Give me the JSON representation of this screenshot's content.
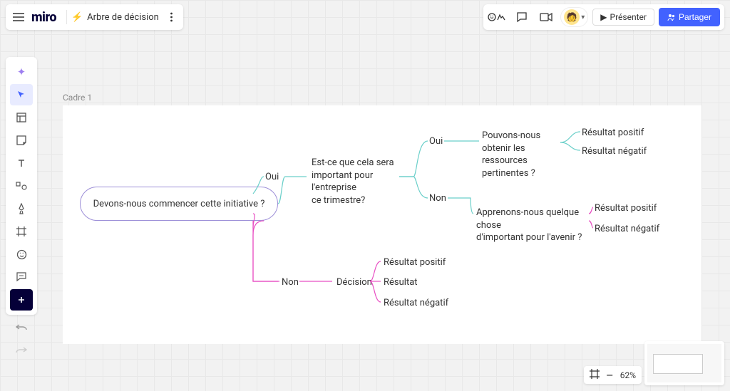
{
  "header": {
    "logo": "miro",
    "board_title": "Arbre de décision",
    "present_label": "Présenter",
    "share_label": "Partager"
  },
  "canvas": {
    "frame_label": "Cadre 1"
  },
  "tree": {
    "root": "Devons-nous commencer cette initiative ?",
    "root_yes": "Oui",
    "root_no": "Non",
    "q_important": "Est-ce que cela sera important pour l'entreprise\nce trimestre?",
    "imp_yes": "Oui",
    "imp_no": "Non",
    "q_resources": "Pouvons-nous obtenir les ressources pertinentes ?",
    "res_pos": "Résultat positif",
    "res_neg": "Résultat négatif",
    "q_learn": "Apprenons-nous quelque chose\nd'important pour l'avenir ?",
    "learn_pos": "Résultat positif",
    "learn_neg": "Résultat négatif",
    "no_decision": "Décision",
    "dec_pos": "Résultat positif",
    "dec_mid": "Résultat",
    "dec_neg": "Résultat négatif"
  },
  "zoom": {
    "level": "62%"
  },
  "colors": {
    "teal": "#6acfc9",
    "magenta": "#e84fc3",
    "purple": "#9d8fd8",
    "accent": "#4262ff"
  }
}
